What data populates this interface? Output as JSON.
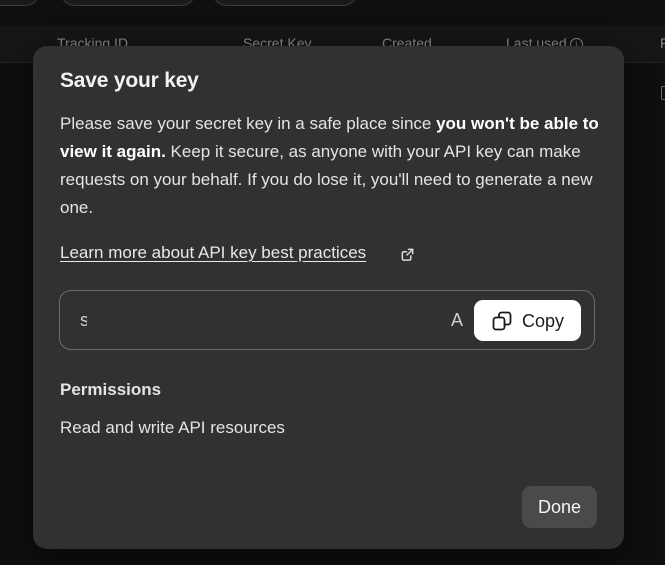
{
  "background": {
    "table_headers": [
      "Tracking ID",
      "Secret Key",
      "Created",
      "Last used",
      "P"
    ]
  },
  "modal": {
    "title": "Save your key",
    "description_pre": "Please save your secret key in a safe place since ",
    "description_bold": "you won't be able to view it again.",
    "description_post": " Keep it secure, as anyone with your API key can make requests on your behalf. If you do lose it, you'll need to generate a new one.",
    "learn_more_link": "Learn more about API key best practices",
    "key_field": {
      "visible_start": "s",
      "visible_end": "A"
    },
    "copy_button": "Copy",
    "permissions_heading": "Permissions",
    "permissions_value": "Read and write API resources",
    "done_button": "Done"
  },
  "colors": {
    "page_background": "#0f0f0f",
    "modal_background": "#313131",
    "copy_button_background": "#ffffff",
    "done_button_background": "#4a4a4a"
  },
  "icons": [
    "info-icon",
    "external-link-icon",
    "copy-icon"
  ]
}
